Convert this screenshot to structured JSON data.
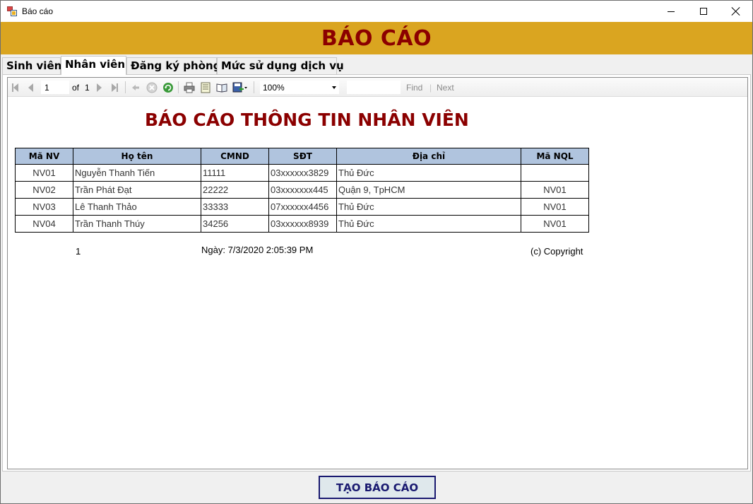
{
  "window": {
    "title": "Báo cáo",
    "icon": "report-app-icon"
  },
  "banner": {
    "title": "BÁO CÁO",
    "color": "#8b0000",
    "background": "#daa520"
  },
  "tabs": [
    {
      "label": "Sinh viên",
      "active": false
    },
    {
      "label": "Nhân viên",
      "active": true
    },
    {
      "label": "Đăng ký phòng",
      "active": false
    },
    {
      "label": "Mức sử dụng dịch vụ",
      "active": false
    }
  ],
  "toolbar": {
    "page_current": "1",
    "page_of_label": "of",
    "page_total": "1",
    "zoom": "100%",
    "find_value": "",
    "find_label": "Find",
    "next_label": "Next",
    "icons": [
      "first-page-icon",
      "prev-page-icon",
      "next-page-icon",
      "last-page-icon",
      "back-icon",
      "stop-icon",
      "refresh-icon",
      "print-icon",
      "print-layout-icon",
      "page-setup-icon",
      "export-icon"
    ]
  },
  "report": {
    "title": "BÁO CÁO THÔNG TIN NHÂN VIÊN",
    "columns": [
      "Mã NV",
      "Họ tên",
      "CMND",
      "SĐT",
      "Địa chỉ",
      "Mã NQL"
    ],
    "rows": [
      [
        "NV01",
        "Nguyễn Thanh Tiến",
        "11111",
        "03xxxxxx3829",
        "Thủ Đức",
        ""
      ],
      [
        "NV02",
        "Trần Phát Đạt",
        "22222",
        "03xxxxxxx445",
        "Quận 9, TpHCM",
        "NV01"
      ],
      [
        "NV03",
        "Lê Thanh Thảo",
        "33333",
        "07xxxxxx4456",
        "Thủ Đức",
        "NV01"
      ],
      [
        "NV04",
        "Trần Thanh Thúy",
        "34256",
        "03xxxxxx8939",
        "Thủ Đức",
        "NV01"
      ]
    ],
    "header_bg": "#b0c4de",
    "footer": {
      "page_number": "1",
      "date": "Ngày: 7/3/2020 2:05:39 PM",
      "copyright": "(c) Copyright"
    }
  },
  "create_button": {
    "label": "TẠO BÁO CÁO",
    "color": "#191970"
  }
}
